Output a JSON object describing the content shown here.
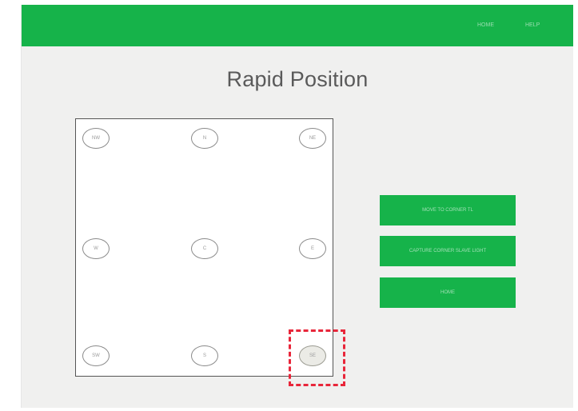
{
  "header": {
    "nav": [
      "HOME",
      "HELP"
    ]
  },
  "page": {
    "title": "Rapid Position"
  },
  "positions": [
    {
      "label": "NW"
    },
    {
      "label": "N"
    },
    {
      "label": "NE"
    },
    {
      "label": "W"
    },
    {
      "label": "C"
    },
    {
      "label": "E"
    },
    {
      "label": "SW"
    },
    {
      "label": "S"
    },
    {
      "label": "SE"
    }
  ],
  "selected_position": "SE",
  "actions": [
    {
      "label": "MOVE TO CORNER TL"
    },
    {
      "label": "CAPTURE CORNER SLAVE LIGHT"
    },
    {
      "label": "HOME"
    }
  ],
  "colors": {
    "header": "#16b34a",
    "button": "#16b34a",
    "selection_outline": "#e8263a",
    "background": "#f0f0ef"
  }
}
